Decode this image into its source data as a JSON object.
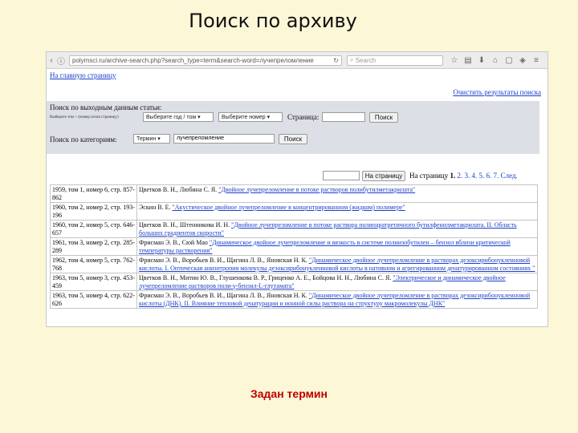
{
  "slide": {
    "title": "Поиск по архиву",
    "caption": "Задан термин"
  },
  "browser": {
    "url": "polymsci.ru/archive-search.php?search_type=term&search-word=лучепреломление",
    "search_placeholder": "Search"
  },
  "page": {
    "home_link": "На главную страницу",
    "clear_link": "Очистить результаты поиска",
    "output_search": {
      "label": "Поиск по выходным данным статьи:",
      "hint": "Выберите том + (номер и/или страницу)",
      "year_volume_select": "Выберите год / том",
      "issue_select": "Выберите номер",
      "page_label": "Страница:",
      "page_value": "",
      "button": "Поиск"
    },
    "category_search": {
      "label": "Поиск по категориям:",
      "category_select": "Термин",
      "term_value": "лучепреломление",
      "button": "Поиск"
    },
    "pager": {
      "go_button": "На страницу",
      "label": "На страницу",
      "current": "1.",
      "pages": [
        "2.",
        "3.",
        "4.",
        "5.",
        "6.",
        "7."
      ],
      "next": "След."
    },
    "results": [
      {
        "source": "1959, том 1, номер 6, стр. 857-862",
        "authors": "Цветков В. Н., Любина С. Я.",
        "title": "\"Двойное лучепреломление в потоке растворов полибутилметакрилата\""
      },
      {
        "source": "1960, том 2, номер 2, стр. 193-196",
        "authors": "Эскин В. Е.",
        "title": "\"Акустическое двойное лучепреломление в концентрированном (жидком) полимере\""
      },
      {
        "source": "1960, том 2, номер 5, стр. 646-657",
        "authors": "Цветков В. Н., Штенникова И. Н.",
        "title": "\"Двойное лучепреломление в потоке раствора полипаратретичного бутилфенилметакрилата. II. Область больших градиентов скорости\""
      },
      {
        "source": "1961, том 3, номер 2, стр. 285-289",
        "authors": "Фрисман Э. В., Сюй Мао",
        "title": "\"Динамическое двойное лучепреломление и вязкость в системе полиизобутилен – бензол вблизи критической температуры растворения\""
      },
      {
        "source": "1962, том 4, номер 5, стр. 762-768",
        "authors": "Фрисман Э. В., Воробьев В. И., Щагина Л. В., Яновская Н. К.",
        "title": "\"Динамическое двойное лучепреломление в растворах дезоксирибонуклеиновой кислоты. I. Оптическая анизотропия молекулы дезоксирибонуклеиновой кислоты в нативном и агрегированном денатурированном состояниях \""
      },
      {
        "source": "1963, том 5, номер 3, стр. 453-459",
        "authors": "Цветков В. Н., Митин Ю. В., Глушенкова В. Р., Гриценко А. Е., Бойцова Н. Н., Любина С. Я.",
        "title": "\"Электрическое и динамическое двойное лучепреломление растворов поли-γ-бензил-L-глутамата\""
      },
      {
        "source": "1963, том 5, номер 4, стр. 622-626",
        "authors": "Фрисман Э. В., Воробьев В. И., Щагина Л. В., Яновская Н. К.",
        "title": "\"Динамическое двойное лучепреломление в растворах дезоксирибонуклеиновой кислоты (ДНК). II. Влияние тепловой денатурации и ионной силы раствора на структуру макромолекулы ДНК\""
      }
    ]
  }
}
